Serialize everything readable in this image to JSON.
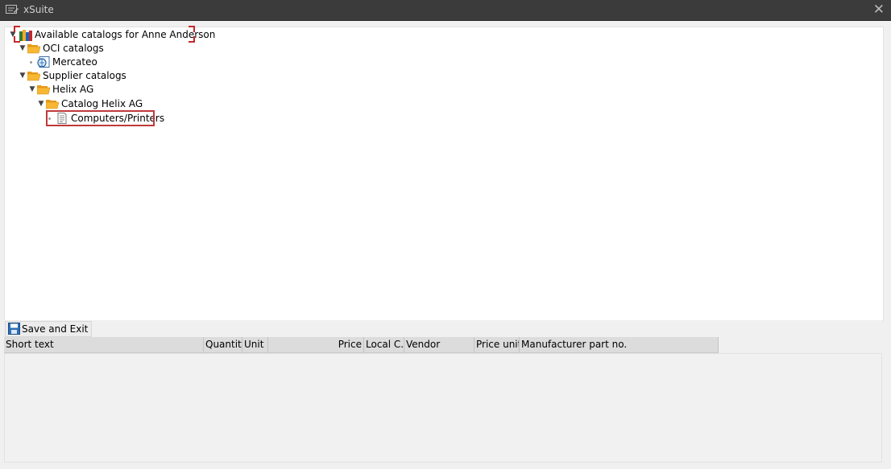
{
  "window": {
    "title": "xSuite",
    "close_glyph": "✕"
  },
  "tree": {
    "root": {
      "label": "Available catalogs for Anne Anderson",
      "icon": "catalog-books-icon"
    },
    "oci": {
      "label": "OCI catalogs",
      "icon": "folder-open-icon"
    },
    "mercateo": {
      "label": "Mercateo",
      "icon": "catalog-web-icon"
    },
    "supplier": {
      "label": "Supplier catalogs",
      "icon": "folder-open-icon"
    },
    "helix": {
      "label": "Helix AG",
      "icon": "folder-open-icon"
    },
    "catalog_helix": {
      "label": "Catalog Helix AG",
      "icon": "folder-open-icon"
    },
    "computers": {
      "label": "Computers/Printers",
      "icon": "document-icon"
    }
  },
  "toolbar": {
    "save_exit_label": "Save and Exit"
  },
  "table": {
    "columns": [
      "Short text",
      "Quantity",
      "Unit",
      "Price",
      "Local C...",
      "Vendor",
      "Price unit",
      "Manufacturer part no."
    ]
  },
  "colors": {
    "titlebar": "#3b3b3b",
    "selection_border": "#c0393b",
    "folder": "#f5a623"
  }
}
